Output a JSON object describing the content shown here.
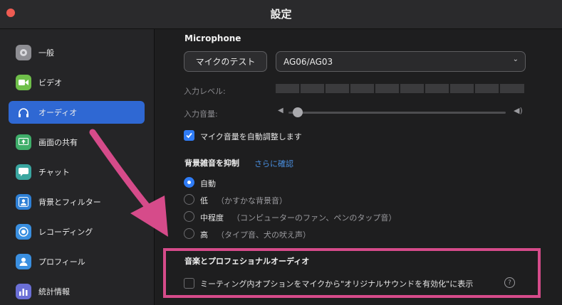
{
  "window": {
    "title": "設定"
  },
  "sidebar": {
    "items": [
      {
        "label": "一般",
        "icon": "gear-icon",
        "color": "#8e8e93",
        "active": false
      },
      {
        "label": "ビデオ",
        "icon": "video-camera-icon",
        "color": "#6fbf4a",
        "active": false
      },
      {
        "label": "オーディオ",
        "icon": "headphones-icon",
        "color": "#2f68d3",
        "active": true
      },
      {
        "label": "画面の共有",
        "icon": "share-screen-icon",
        "color": "#3fae6a",
        "active": false
      },
      {
        "label": "チャット",
        "icon": "chat-bubble-icon",
        "color": "#3aa6a0",
        "active": false
      },
      {
        "label": "背景とフィルター",
        "icon": "person-background-icon",
        "color": "#2f80d6",
        "active": false
      },
      {
        "label": "レコーディング",
        "icon": "record-icon",
        "color": "#3a8fe0",
        "active": false
      },
      {
        "label": "プロフィール",
        "icon": "person-icon",
        "color": "#3a8fe0",
        "active": false
      },
      {
        "label": "統計情報",
        "icon": "bar-chart-icon",
        "color": "#6b6fd6",
        "active": false
      }
    ]
  },
  "audio": {
    "microphone_title": "Microphone",
    "test_button": "マイクのテスト",
    "device_selected": "AG06/AG03",
    "input_level_label": "入力レベル:",
    "input_volume_label": "入力音量:",
    "auto_adjust_label": "マイク音量を自動調整します",
    "auto_adjust_checked": true,
    "noise_title": "背景雑音を抑制",
    "noise_link": "さらに確認",
    "noise_options": [
      {
        "label": "自動",
        "hint": "",
        "selected": true
      },
      {
        "label": "低",
        "hint": "（かすかな背景音）",
        "selected": false
      },
      {
        "label": "中程度",
        "hint": "（コンピューターのファン、ペンのタップ音）",
        "selected": false
      },
      {
        "label": "高",
        "hint": "（タイプ音、犬の吠え声）",
        "selected": false
      }
    ],
    "music_title": "音楽とプロフェショナルオーディオ",
    "original_sound_label": "ミーティング内オプションをマイクから\"オリジナルサウンドを有効化\"に表示",
    "original_sound_checked": false,
    "help_glyph": "?"
  },
  "colors": {
    "accent": "#2f7cf6",
    "annotation": "#d64b8a"
  }
}
